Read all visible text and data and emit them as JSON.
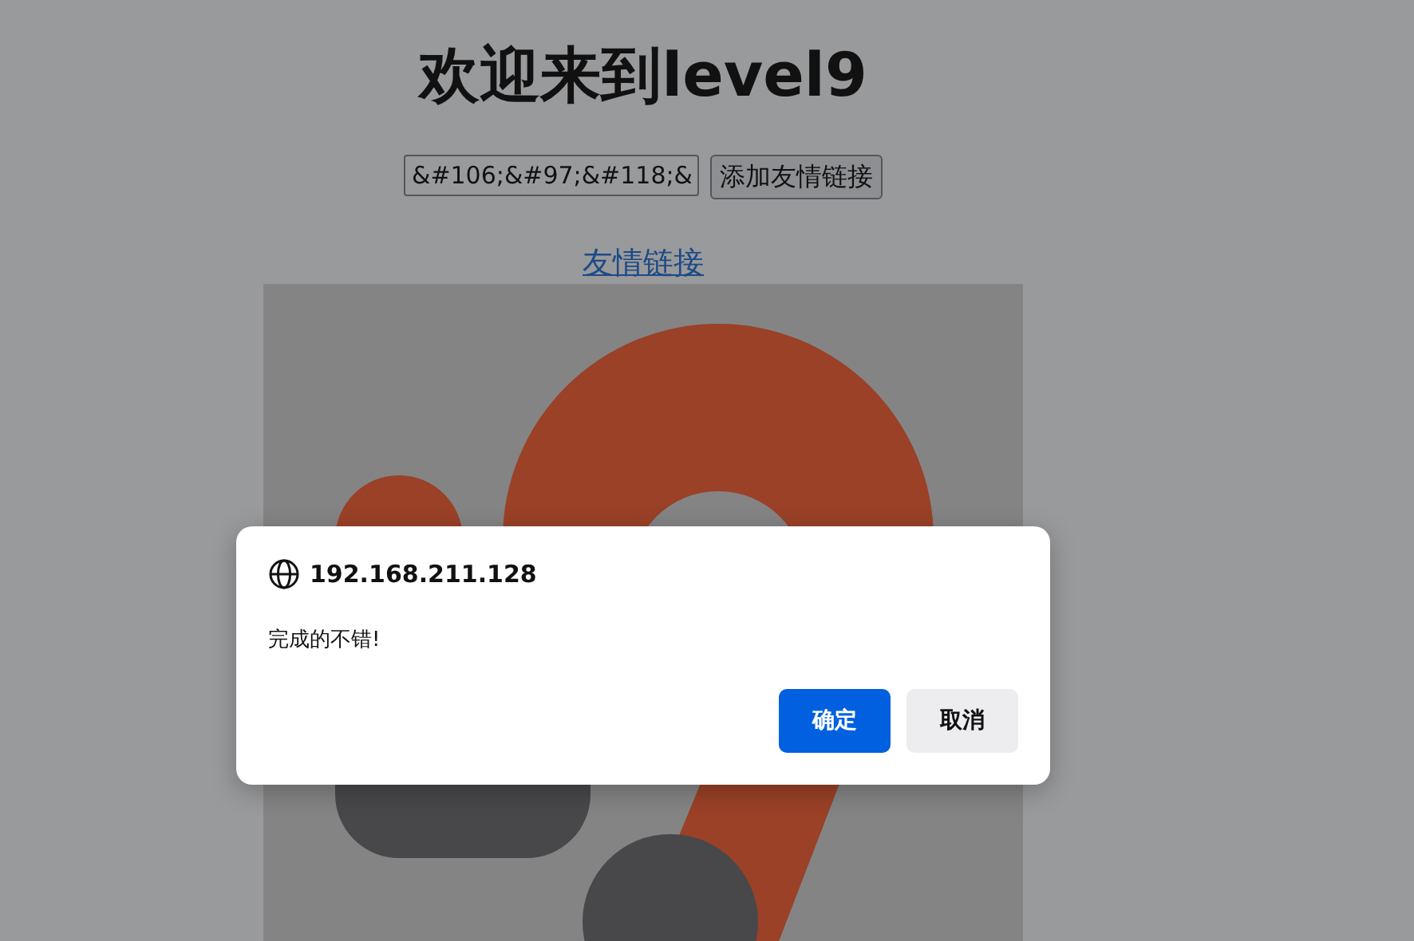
{
  "page": {
    "heading": "欢迎来到level9",
    "link_input": {
      "value": "&#106;&#97;&#118;&"
    },
    "add_button": "添加友情链接",
    "friend_link": "友情链接"
  },
  "alert": {
    "origin": "192.168.211.128",
    "message": "完成的不错!",
    "buttons": [
      {
        "label": "确定",
        "kind": "primary"
      },
      {
        "label": "取消",
        "kind": "secondary"
      }
    ]
  }
}
